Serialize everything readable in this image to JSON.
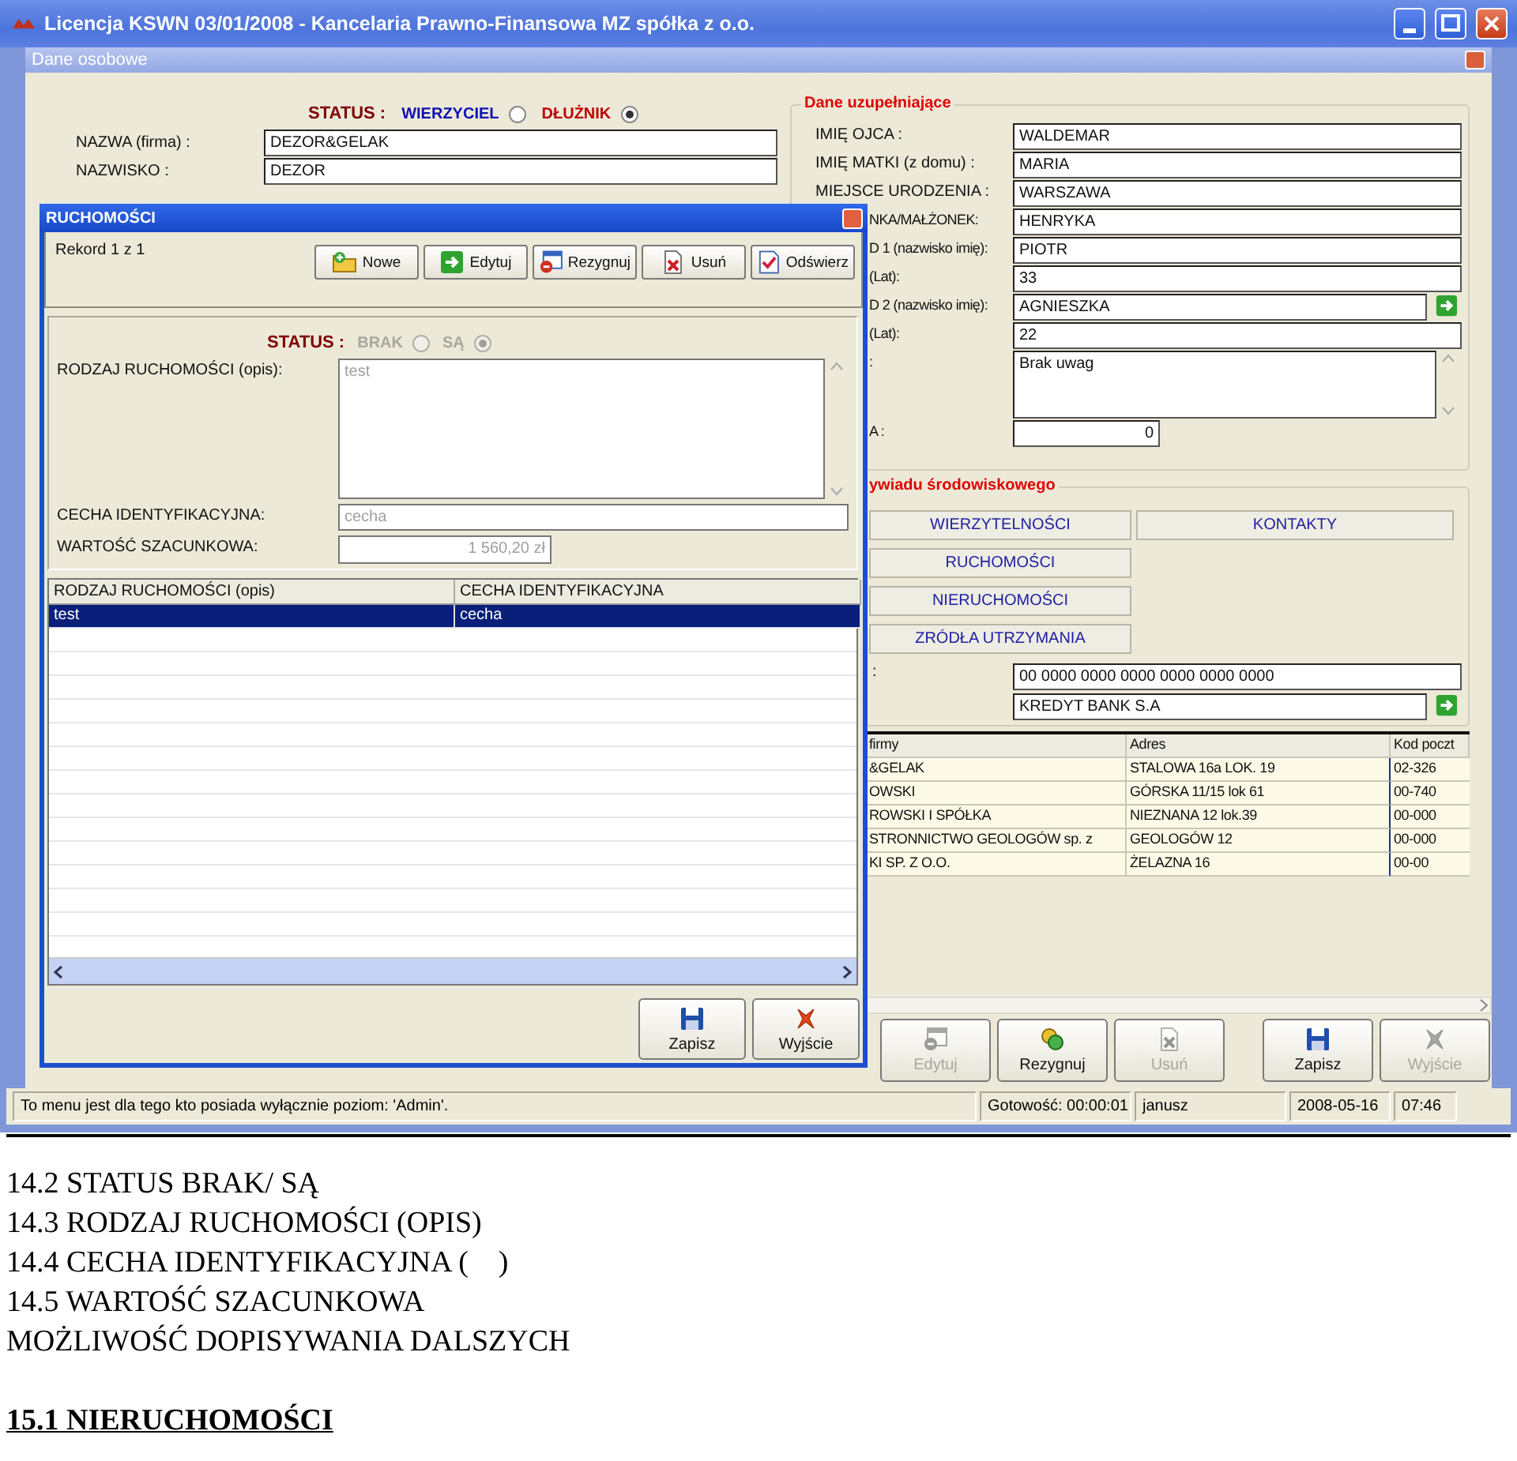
{
  "window": {
    "title": "Licencja KSWN 03/01/2008 - Kancelaria Prawno-Finansowa MZ spółka z o.o.",
    "child_title": "Dane osobowe"
  },
  "form": {
    "status": {
      "label": "STATUS :",
      "options": [
        {
          "label": "WIERZYCIEL",
          "color": "#1010b0",
          "selected": false
        },
        {
          "label": "DŁUŻNIK",
          "color": "#c00000",
          "selected": true
        }
      ]
    },
    "fields": [
      {
        "label": "NAZWA (firma) :",
        "value": "DEZOR&GELAK"
      },
      {
        "label": "NAZWISKO :",
        "value": "DEZOR"
      }
    ]
  },
  "details": {
    "title": "Dane uzupełniające",
    "fields": [
      {
        "kind": "text",
        "label": "IMIĘ OJCA :",
        "value": "WALDEMAR"
      },
      {
        "kind": "text",
        "label": "IMIĘ MATKI (z domu) :",
        "value": "MARIA"
      },
      {
        "kind": "text",
        "label": "MIEJSCE URODZENIA :",
        "value": "WARSZAWA"
      },
      {
        "kind": "text",
        "label": "NKA/MAŁŻONEK:",
        "value": "HENRYKA"
      },
      {
        "kind": "text",
        "label": "D 1 (nazwisko imię):",
        "value": "PIOTR"
      },
      {
        "kind": "text",
        "label": "(Lat):",
        "value": "33"
      },
      {
        "kind": "lookup",
        "label": "D 2 (nazwisko imię):",
        "value": "AGNIESZKA"
      },
      {
        "kind": "text",
        "label": "(Lat):",
        "value": "22"
      },
      {
        "kind": "memo",
        "label": ":",
        "value": "Brak uwag"
      },
      {
        "kind": "number",
        "label": "A :",
        "value": "0"
      }
    ]
  },
  "interview": {
    "title": "ywiadu środowiskowego",
    "buttons": [
      "WIERZYTELNOŚCI",
      "KONTAKTY",
      "RUCHOMOŚCI",
      "NIERUCHOMOŚCI",
      "ZRÓDŁA UTRZYMANIA"
    ],
    "account": {
      "label": ":",
      "number": "00 0000 0000 0000 0000 0000 0000",
      "bank": "KREDYT BANK S.A"
    }
  },
  "companies": {
    "columns": [
      "firmy",
      "Adres",
      "Kod poczt"
    ],
    "rows": [
      [
        "&GELAK",
        "STALOWA 16a LOK. 19",
        "02-326"
      ],
      [
        "OWSKI",
        "GÓRSKA 11/15 lok 61",
        "00-740"
      ],
      [
        "ROWSKI I SPÓŁKA",
        "NIEZNANA 12 lok.39",
        "00-000"
      ],
      [
        "STRONNICTWO GEOLOGÓW sp. z",
        "GEOLOGÓW 12",
        "00-000"
      ],
      [
        "KI SP. Z O.O.",
        "ŻELAZNA 16",
        "00-00"
      ]
    ]
  },
  "toolbar": [
    {
      "label": "Edytuj",
      "disabled": true
    },
    {
      "label": "Rezygnuj",
      "disabled": false
    },
    {
      "label": "Usuń",
      "disabled": true
    },
    {
      "label": "Zapisz",
      "disabled": false
    },
    {
      "label": "Wyjście",
      "disabled": true
    }
  ],
  "status_bar": [
    "To menu jest dla tego kto posiada wyłącznie poziom: 'Admin'.",
    "Gotowość: 00:00:01",
    "janusz",
    "2008-05-16",
    "07:46"
  ],
  "dialog": {
    "title": "RUCHOMOŚCI",
    "record": "Rekord 1 z 1",
    "buttons": [
      "Nowe",
      "Edytuj",
      "Rezygnuj",
      "Usuń",
      "Odświerz"
    ],
    "status": {
      "label": "STATUS :",
      "disabled": true,
      "options": [
        {
          "label": "BRAK",
          "selected": false
        },
        {
          "label": "SĄ",
          "selected": true
        }
      ]
    },
    "fields": [
      {
        "kind": "memo",
        "label": "RODZAJ RUCHOMOŚCI (opis):",
        "value": "test",
        "disabled": true
      },
      {
        "kind": "text",
        "label": "CECHA IDENTYFIKACYJNA:",
        "value": "cecha",
        "disabled": true
      },
      {
        "kind": "money",
        "label": "WARTOŚĆ SZACUNKOWA:",
        "value": "1 560,20 zł",
        "disabled": true
      }
    ],
    "grid": {
      "columns": [
        "RODZAJ RUCHOMOŚCI (opis)",
        "CECHA IDENTYFIKACYJNA"
      ],
      "rows": [
        {
          "cells": [
            "test",
            "cecha"
          ],
          "selected": true
        }
      ]
    },
    "footer_buttons": [
      "Zapisz",
      "Wyjście"
    ]
  },
  "document": {
    "lines": [
      "14.2 STATUS BRAK/ SĄ",
      "14.3 RODZAJ RUCHOMOŚCI (OPIS)",
      "14.4 CECHA IDENTYFIKACYJNA (    )",
      "14.5 WARTOŚĆ SZACUNKOWA",
      "MOŻLIWOŚĆ DOPISYWANIA DALSZYCH"
    ],
    "heading": "15.1 NIERUCHOMOŚCI"
  }
}
